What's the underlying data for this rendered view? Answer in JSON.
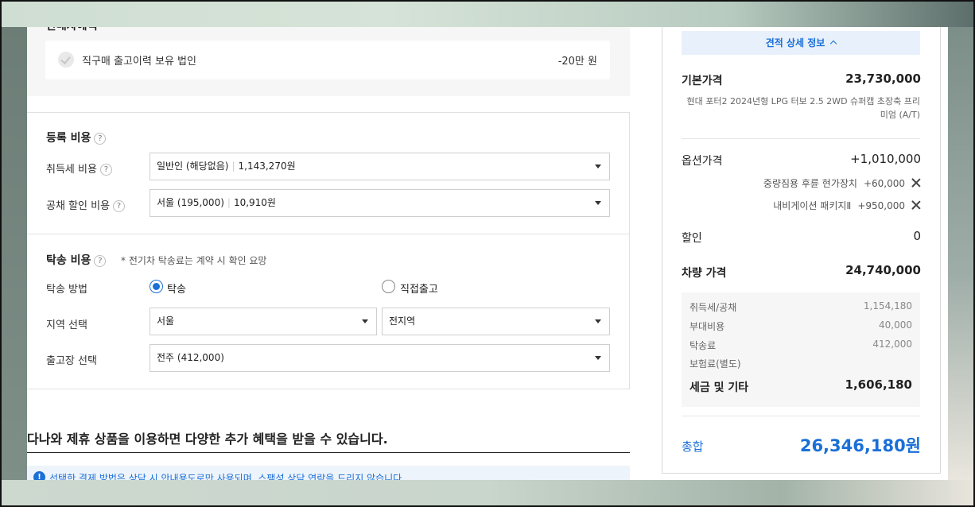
{
  "benefit": {
    "title": "판매자혜택",
    "item_label": "직구매 출고이력 보유 법인",
    "item_value": "-20만 원"
  },
  "registration": {
    "title": "등록 비용",
    "help": "?",
    "acq_tax_label": "취득세 비용",
    "acq_tax_option": "일반인 (해당없음)",
    "acq_tax_amount": "1,143,270원",
    "bond_label": "공채 할인 비용",
    "bond_option": "서울 (195,000)",
    "bond_amount": "10,910원"
  },
  "delivery": {
    "title": "탁송 비용",
    "help": "?",
    "note": "* 전기차 탁송료는 계약 시 확인 요망",
    "method_label": "탁송 방법",
    "method_options": [
      "탁송",
      "직접출고"
    ],
    "method_selected": "탁송",
    "region_label": "지역 선택",
    "region_city": "서울",
    "region_district": "전지역",
    "depot_label": "출고장 선택",
    "depot_value": "전주 (412,000)"
  },
  "promo": {
    "title": "다나와 제휴 상품을 이용하면 다양한 추가 혜택을 받을 수 있습니다.",
    "info": "선택한 결제 방법은 상담 시 안내용도로만 사용되며, 스팸성 상담 연락을 드리지 않습니다."
  },
  "summary": {
    "detail_button": "견적 상세 정보",
    "base_label": "기본가격",
    "base_value": "23,730,000",
    "model_desc": "현대 포터2 2024년형 LPG 터보 2.5 2WD 슈퍼캡 초장축 프리미엄 (A/T)",
    "option_label": "옵션가격",
    "option_value": "+1,010,000",
    "options": [
      {
        "name": "중량짐용 후륜 현가장치",
        "price": "+60,000"
      },
      {
        "name": "내비게이션 패키지Ⅱ",
        "price": "+950,000"
      }
    ],
    "discount_label": "할인",
    "discount_value": "0",
    "vehicle_label": "차량 가격",
    "vehicle_value": "24,740,000",
    "tax_items": [
      {
        "label": "취득세/공채",
        "value": "1,154,180"
      },
      {
        "label": "부대비용",
        "value": "40,000"
      },
      {
        "label": "탁송료",
        "value": "412,000"
      },
      {
        "label": "보험료(별도)",
        "value": ""
      }
    ],
    "tax_total_label": "세금 및 기타",
    "tax_total_value": "1,606,180",
    "grand_label": "총합",
    "grand_value": "26,346,180원"
  },
  "colors": {
    "accent": "#1a6fd8",
    "panel_bg": "#f6f6f6"
  }
}
